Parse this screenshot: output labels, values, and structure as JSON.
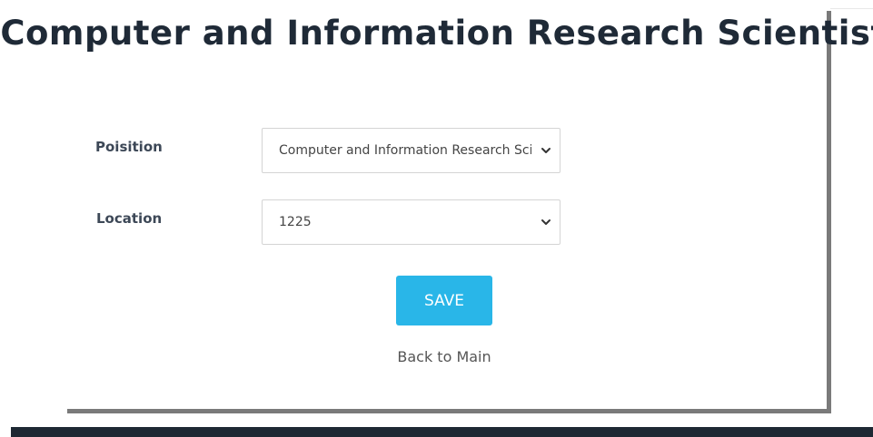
{
  "page": {
    "title": "Computer and Information Research Scientist"
  },
  "form": {
    "position": {
      "label": "Poisition",
      "value": "Computer and Information Research Scientist"
    },
    "location": {
      "label": "Location",
      "value": "1225"
    },
    "save_label": "SAVE",
    "back_label": "Back to Main"
  },
  "colors": {
    "primary_button": "#29b6e8",
    "title_text": "#1f2a37",
    "footer": "#1e2833"
  },
  "icons": {
    "select_arrow": "chevron-down-icon"
  }
}
